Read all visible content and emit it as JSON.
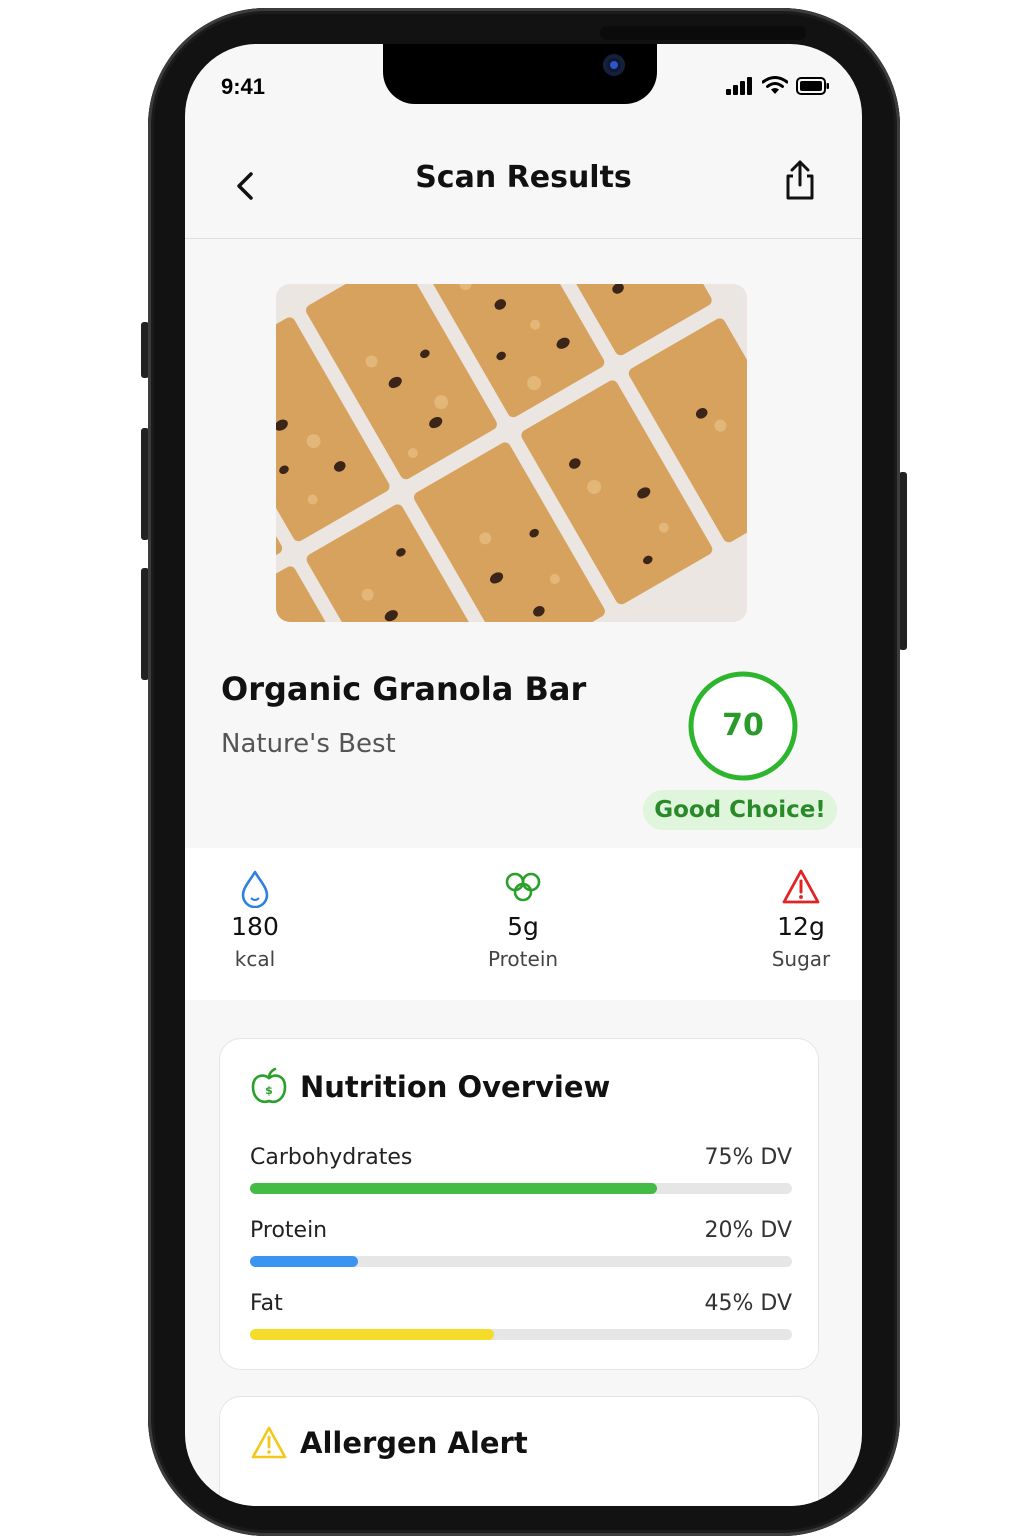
{
  "status_bar": {
    "time": "9:41"
  },
  "header": {
    "title": "Scan Results"
  },
  "product": {
    "name": "Organic Granola Bar",
    "brand": "Nature's Best"
  },
  "score": {
    "value": "70",
    "fraction": 0.7,
    "badge": "Good Choice!",
    "color": "#2db52d"
  },
  "quick_stats": [
    {
      "icon": "drop-icon",
      "value": "180",
      "unit": "kcal",
      "color": "#2f7fe0"
    },
    {
      "icon": "protein-icon",
      "value": "5g",
      "unit": "Protein",
      "color": "#2aa02a"
    },
    {
      "icon": "warning-icon",
      "value": "12g",
      "unit": "Sugar",
      "color": "#e02424"
    }
  ],
  "nutrition": {
    "title": "Nutrition Overview",
    "icon": "apple-icon",
    "rows": [
      {
        "label": "Carbohydrates",
        "dv": "75% DV",
        "fraction": 0.75,
        "color": "#44bb44"
      },
      {
        "label": "Protein",
        "dv": "20% DV",
        "fraction": 0.2,
        "color": "#3b95f0"
      },
      {
        "label": "Fat",
        "dv": "45% DV",
        "fraction": 0.45,
        "color": "#f5dc2a"
      }
    ]
  },
  "allergen": {
    "title": "Allergen Alert",
    "icon": "warning-icon",
    "color": "#f2c81a"
  }
}
